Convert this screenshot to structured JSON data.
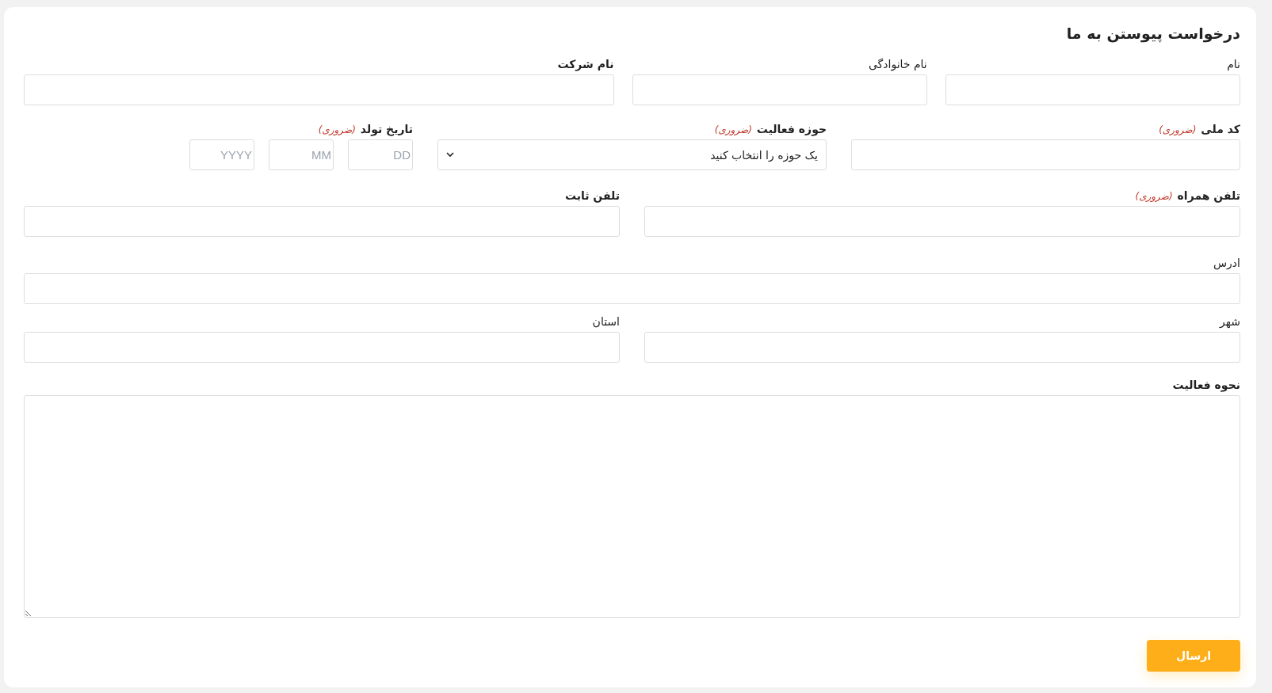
{
  "form": {
    "title": "درخواست پیوستن به ما",
    "sections": [
      {
        "fields": [
          {
            "kind": "text",
            "label": "نام",
            "bold": false
          },
          {
            "kind": "text",
            "label": "نام خانوادگی",
            "bold": false
          },
          {
            "kind": "text",
            "label": "نام شرکت",
            "bold": true
          }
        ]
      },
      {
        "fields": [
          {
            "kind": "text",
            "label": "کد ملی",
            "bold": true,
            "required_note": "(ضروری)"
          },
          {
            "kind": "select",
            "label": "حوزه فعالیت",
            "bold": true,
            "required_note": "(ضروری)",
            "placeholder": "یک حوزه را انتخاب کنید"
          },
          {
            "kind": "date",
            "label": "تاریخ تولد",
            "bold": true,
            "required_note": "(ضروری)",
            "parts": [
              {
                "placeholder": "DD"
              },
              {
                "placeholder": "MM"
              },
              {
                "placeholder": "YYYY"
              }
            ]
          }
        ]
      },
      {
        "fields": [
          {
            "kind": "text",
            "label": "تلفن همراه",
            "bold": true,
            "required_note": "(ضروری)"
          },
          {
            "kind": "text",
            "label": "تلفن ثابت",
            "bold": true
          }
        ]
      },
      {
        "fields": [
          {
            "kind": "text",
            "label": "ادرس",
            "bold": false
          }
        ]
      },
      {
        "fields": [
          {
            "kind": "text",
            "label": "شهر",
            "bold": false
          },
          {
            "kind": "text",
            "label": "استان",
            "bold": false
          }
        ]
      },
      {
        "fields": [
          {
            "kind": "textarea",
            "label": "نحوه فعالیت",
            "bold": true
          }
        ]
      }
    ],
    "submit": "ارسال"
  }
}
